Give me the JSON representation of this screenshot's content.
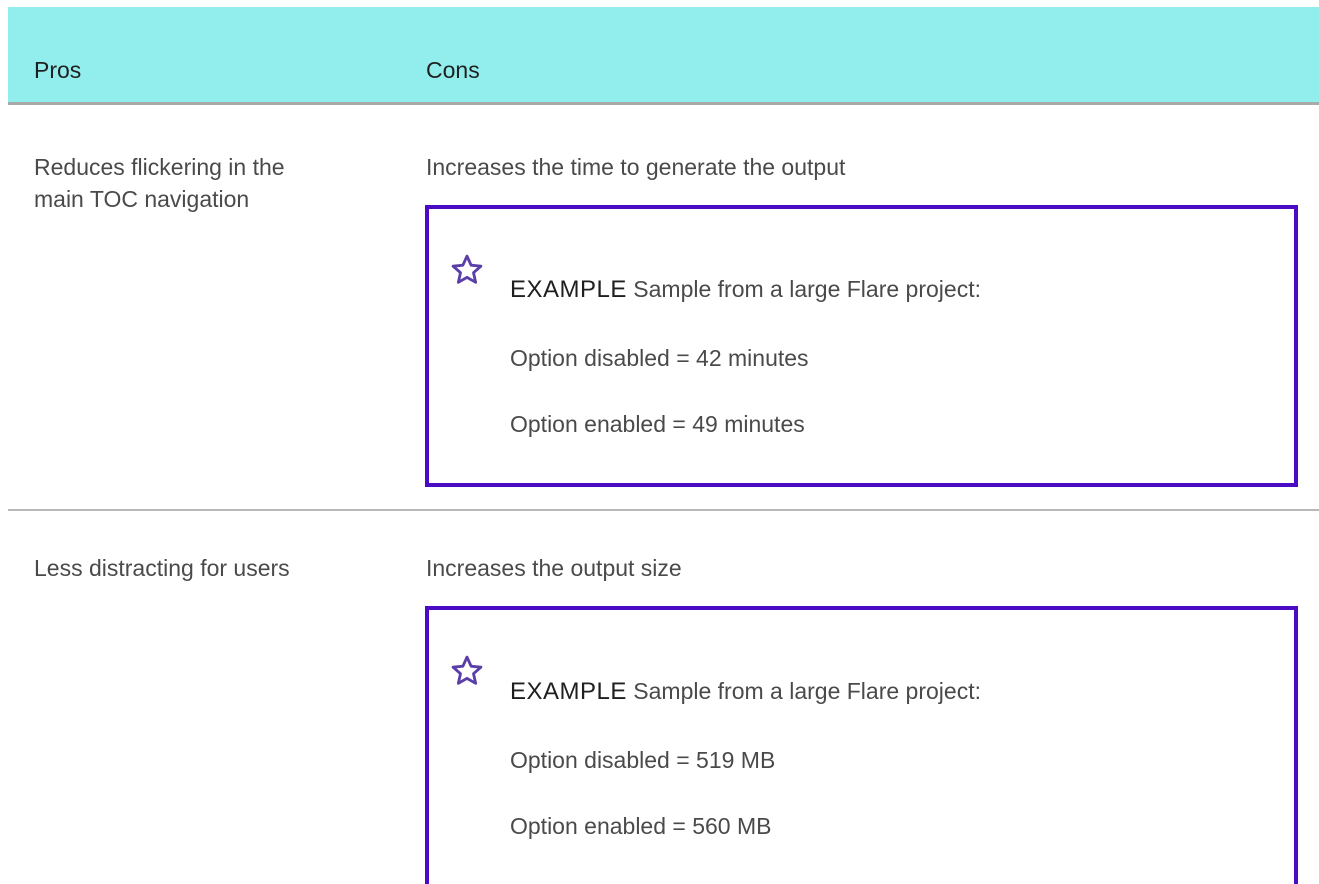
{
  "table": {
    "headers": {
      "pros": "Pros",
      "cons": "Cons"
    },
    "rows": [
      {
        "pros_line1": "Reduces flickering in the",
        "pros_line2": "main TOC navigation",
        "cons": "Increases the time to generate the output",
        "example": {
          "icon": "star-icon",
          "label": "EXAMPLE",
          "intro": "Sample from a large Flare project:",
          "line1": "Option disabled = 42 minutes",
          "line2": "Option enabled = 49 minutes"
        }
      },
      {
        "pros_line1": "Less distracting for users",
        "cons": "Increases the output size",
        "example": {
          "icon": "star-icon",
          "label": "EXAMPLE",
          "intro": "Sample from a large Flare project:",
          "line1": "Option disabled = 519 MB",
          "line2": "Option enabled = 560 MB"
        }
      }
    ]
  },
  "colors": {
    "header_background": "#92eeec",
    "example_border": "#4b0bc4",
    "star_icon": "#5b3fa8"
  }
}
